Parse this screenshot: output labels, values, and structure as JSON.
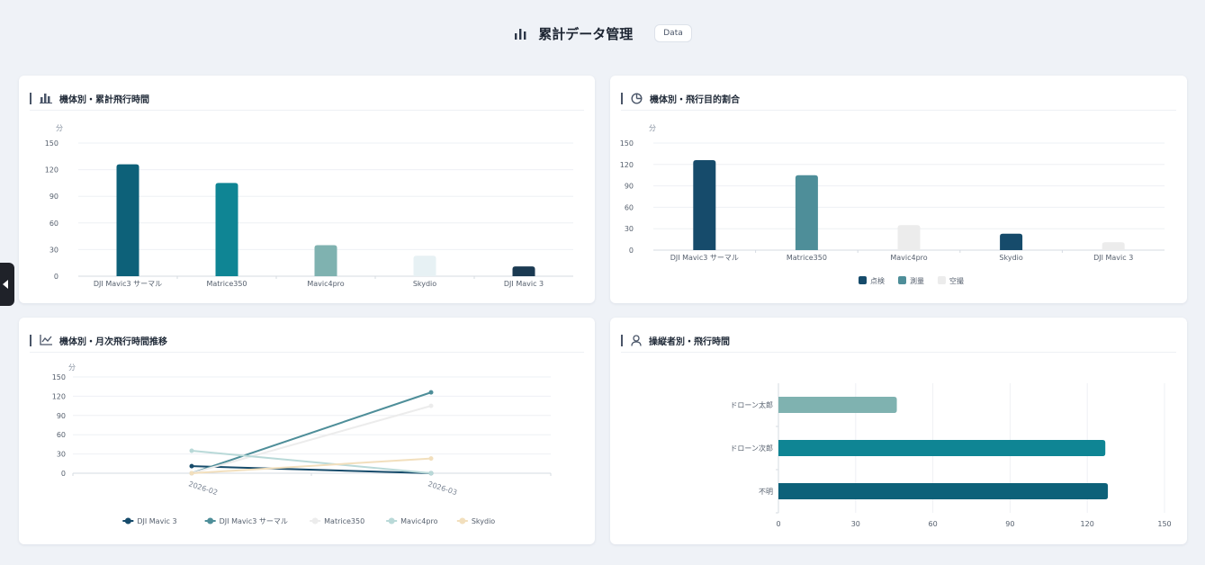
{
  "header": {
    "title": "累計データ管理",
    "badge": "Data"
  },
  "colors": {
    "navy": "#164b6b",
    "teal_dark": "#0d6179",
    "teal": "#0f8594",
    "slate_teal": "#4e8e99",
    "sage": "#7fb2b0",
    "pale": "#e7f1f4",
    "light_gray": "#ececec",
    "dark": "#1b3a52",
    "pale_teal": "#b9d9d8",
    "cream": "#f2dfbd"
  },
  "cards": {
    "machine_total": {
      "title": "機体別・累計飛行時間",
      "icon": "bar-chart-icon",
      "chart_data": {
        "type": "bar",
        "ylabel": "分",
        "ylim": [
          0,
          150
        ],
        "yticks": [
          0,
          30,
          60,
          90,
          120,
          150
        ],
        "categories": [
          "DJI Mavic3 サーマル",
          "Matrice350",
          "Mavic4pro",
          "Skydio",
          "DJI Mavic 3"
        ],
        "values": [
          126,
          105,
          35,
          23,
          11
        ],
        "bar_colors": [
          "#0d6179",
          "#0f8594",
          "#7fb2b0",
          "#e7f1f4",
          "#1b3a52"
        ]
      }
    },
    "purpose_ratio": {
      "title": "機体別・飛行目的割合",
      "icon": "pie-chart-icon",
      "chart_data": {
        "type": "bar",
        "ylabel": "分",
        "ylim": [
          0,
          150
        ],
        "yticks": [
          0,
          30,
          60,
          90,
          120,
          150
        ],
        "categories": [
          "DJI Mavic3 サーマル",
          "Matrice350",
          "Mavic4pro",
          "Skydio",
          "DJI Mavic 3"
        ],
        "values": [
          126,
          105,
          35,
          23,
          11
        ],
        "bar_colors": [
          "#164b6b",
          "#4e8e99",
          "#ececec",
          "#164b6b",
          "#ececec"
        ],
        "legend": [
          {
            "name": "点検",
            "color": "#164b6b"
          },
          {
            "name": "測量",
            "color": "#4e8e99"
          },
          {
            "name": "空撮",
            "color": "#ececec"
          }
        ],
        "legend_position": "bottom"
      }
    },
    "monthly_trend": {
      "title": "機体別・月次飛行時間推移",
      "icon": "line-chart-icon",
      "chart_data": {
        "type": "line",
        "ylabel": "分",
        "ylim": [
          0,
          150
        ],
        "yticks": [
          0,
          30,
          60,
          90,
          120,
          150
        ],
        "x": [
          "2026-02",
          "2026-03"
        ],
        "series": [
          {
            "name": "DJI Mavic 3",
            "color": "#164b6b",
            "values": [
              11,
              0
            ]
          },
          {
            "name": "DJI Mavic3 サーマル",
            "color": "#4e8e99",
            "values": [
              0,
              126
            ]
          },
          {
            "name": "Matrice350",
            "color": "#ececec",
            "values": [
              0,
              105
            ]
          },
          {
            "name": "Mavic4pro",
            "color": "#b9d9d8",
            "values": [
              35,
              0
            ]
          },
          {
            "name": "Skydio",
            "color": "#f2dfbd",
            "values": [
              0,
              23
            ]
          }
        ],
        "legend_position": "bottom"
      }
    },
    "operator_time": {
      "title": "操縦者別・飛行時間",
      "icon": "user-icon",
      "chart_data": {
        "type": "bar",
        "orientation": "horizontal",
        "xlim": [
          0,
          150
        ],
        "xticks": [
          0,
          30,
          60,
          90,
          120,
          150
        ],
        "categories": [
          "ドローン太郎",
          "ドローン次郎",
          "不明"
        ],
        "values": [
          46,
          127,
          128
        ],
        "bar_colors": [
          "#7fb2b0",
          "#0f8594",
          "#0d6179"
        ]
      }
    }
  }
}
